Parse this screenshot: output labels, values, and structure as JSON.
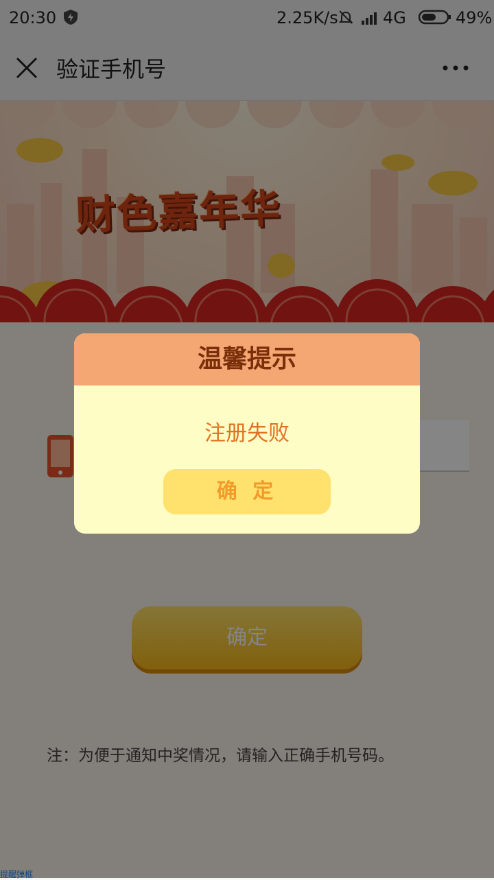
{
  "status_bar": {
    "time": "20:30",
    "network_speed": "2.25K/s",
    "network_type": "4G",
    "battery": "49%"
  },
  "nav": {
    "title": "验证手机号",
    "close_icon": "close-icon",
    "more_icon": "more-icon"
  },
  "banner": {
    "headline": "财色嘉年华"
  },
  "form": {
    "submit_label": "确定",
    "note": "注：为便于通知中奖情况，请输入正确手机号码。",
    "bottom_link": "提醒弹框"
  },
  "dialog": {
    "title": "温馨提示",
    "message": "注册失败",
    "confirm_label": "确 定"
  },
  "colors": {
    "dialog_header": "#f4a772",
    "dialog_body": "#fffdc6",
    "dialog_button": "#ffe16d",
    "accent_text": "#e07222"
  }
}
